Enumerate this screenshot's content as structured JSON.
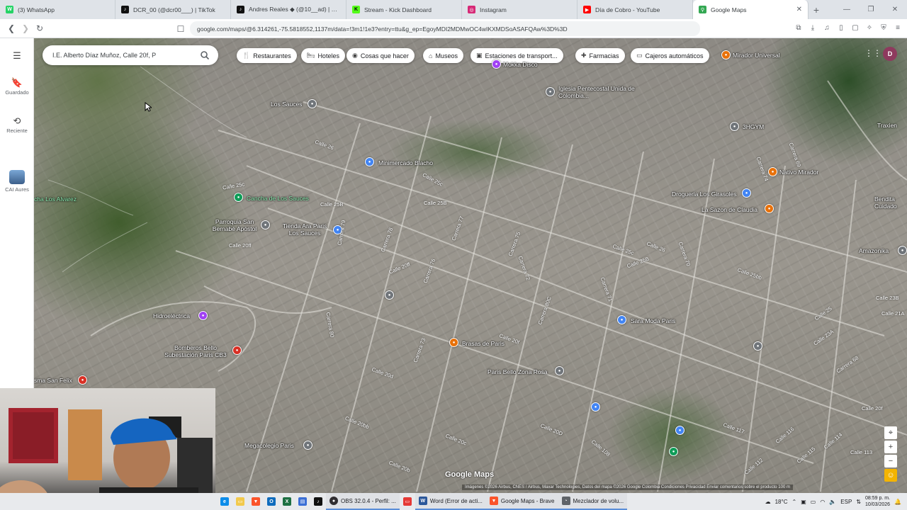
{
  "browser": {
    "tabs": [
      {
        "label": "(3) WhatsApp",
        "icon": "whatsapp-icon",
        "color": "#25d366",
        "glyph": "W"
      },
      {
        "label": "DCR_00 (@dcr00___) | TikTok",
        "icon": "tiktok-icon",
        "color": "#111111",
        "glyph": "♪"
      },
      {
        "label": "Andres Reales ◆ (@10__ad) | TikTok",
        "icon": "tiktok-icon",
        "color": "#111111",
        "glyph": "♪"
      },
      {
        "label": "Stream - Kick Dashboard",
        "icon": "kick-icon",
        "color": "#53fc18",
        "glyph": "K"
      },
      {
        "label": "Instagram",
        "icon": "instagram-icon",
        "color": "#d62976",
        "glyph": "◎"
      },
      {
        "label": "Día de Cobro - YouTube",
        "icon": "youtube-icon",
        "color": "#ff0000",
        "glyph": "▶"
      },
      {
        "label": "Google Maps",
        "icon": "google-maps-icon",
        "color": "#34a853",
        "glyph": "⚲"
      }
    ],
    "url": "google.com/maps/@6.314261,-75.5818552,1137m/data=!3m1!1e3?entry=ttu&g_ep=EgoyMDI2MDMwOC4wIKXMDSoASAFQAw%3D%3D"
  },
  "rail": {
    "items": [
      {
        "label": "Guardado",
        "icon": "bookmark-icon"
      },
      {
        "label": "Reciente",
        "icon": "history-icon"
      },
      {
        "label": "CAI Aures",
        "icon": "place-thumbnail"
      }
    ]
  },
  "search": {
    "value": "I.E. Alberto Díaz Muñoz, Calle 20f, P"
  },
  "chips": [
    {
      "label": "Restaurantes",
      "icon": "restaurant-icon",
      "glyph": "🍴"
    },
    {
      "label": "Hoteles",
      "icon": "hotel-icon",
      "glyph": "🛏"
    },
    {
      "label": "Cosas que hacer",
      "icon": "camera-icon",
      "glyph": "◉"
    },
    {
      "label": "Museos",
      "icon": "museum-icon",
      "glyph": "⌂"
    },
    {
      "label": "Estaciones de transport...",
      "icon": "transit-icon",
      "glyph": "▣"
    },
    {
      "label": "Farmacias",
      "icon": "pharmacy-icon",
      "glyph": "✚"
    },
    {
      "label": "Cajeros automáticos",
      "icon": "atm-icon",
      "glyph": "▭"
    }
  ],
  "map": {
    "places": [
      {
        "label": "Mirador Universal",
        "color": "#e8710a"
      },
      {
        "label": "Mokka Disco",
        "color": "#a142f4"
      },
      {
        "label": "Iglesia Pentecostal Unida de Colombia...",
        "color": "#70757a"
      },
      {
        "label": "Los Sauces",
        "color": "#70757a"
      },
      {
        "label": "3HGYM",
        "color": "#70757a"
      },
      {
        "label": "Traxien",
        "color": "#70757a"
      },
      {
        "label": "Nativo Mirador",
        "color": "#e8710a"
      },
      {
        "label": "Minimercado Blacho",
        "color": "#4285f4"
      },
      {
        "label": "Cancha de Los Sauces",
        "color": "#0f9d58"
      },
      {
        "label": "Drogueria Los Girasoles",
        "color": "#4285f4"
      },
      {
        "label": "La Sazon de Claudia",
        "color": "#e8710a"
      },
      {
        "label": "Bendita Cuidado",
        "color": "#70757a"
      },
      {
        "label": "Parroquia San Bernabé Apóstol",
        "color": "#70757a"
      },
      {
        "label": "Tienda Ara Paris Los Sauces",
        "color": "#4285f4"
      },
      {
        "label": "Amazonika",
        "color": "#70757a"
      },
      {
        "label": "Hidroeléctrica",
        "color": "#a142f4"
      },
      {
        "label": "Sara Moda Paris",
        "color": "#4285f4"
      },
      {
        "label": "Brasas de Paris",
        "color": "#e8710a"
      },
      {
        "label": "Bomberos Bello Subestación Paris CB3",
        "color": "#d93025"
      },
      {
        "label": "Paris Bello Zona Rosa",
        "color": "#70757a"
      },
      {
        "label": "Megacolegio Paris",
        "color": "#70757a"
      },
      {
        "label": "sma San Felix",
        "color": "#d93025"
      },
      {
        "label": "cha Los Alvarez",
        "color": "#0f9d58"
      }
    ],
    "streets": [
      "Calle 26",
      "Calle 25c",
      "Calle 25B",
      "Calle 25c",
      "Calle 25B",
      "Calle 20ff",
      "Calle 20ff",
      "Calle 25B",
      "Calle 25c",
      "Calle 26",
      "Calle 25bb",
      "Calle 25",
      "Calle 23A",
      "Calle 20f",
      "Calle 20d",
      "Calle 20bb",
      "Calle 20c",
      "Calle 20b",
      "Calle 20D",
      "Calle 117",
      "Calle 116",
      "Calle 113",
      "Calle 114",
      "Calle 115",
      "Calle 112",
      "Calle 108",
      "Calle 20f",
      "Carrera 69",
      "Carrera 70",
      "Carrera 71",
      "Carrera 72",
      "Carrera 73",
      "Carrera 75",
      "Carrera 76",
      "Carrera 77",
      "Carrera 78",
      "Carrera 79",
      "Carrera 80",
      "Carrera 80C",
      "Carrera 74",
      "Carrera 68",
      "Calle 21A",
      "Calle 23B",
      "Calle 24"
    ],
    "logo": "Google Maps",
    "attribution": "Imágenes ©2026 Airbus, CNES / Airbus, Maxar Technologies, Datos del mapa ©2026 Google   Colombia   Condiciones   Privacidad   Enviar comentarios sobre el producto   100 m",
    "avatar_letter": "D"
  },
  "taskbar": {
    "apps": [
      {
        "label": "OBS 32.0.4 - Perfil: ...",
        "icon": "obs-icon",
        "color": "#302e31",
        "glyph": "●"
      },
      {
        "label": "Word (Error de acti...",
        "icon": "word-icon",
        "color": "#2b579a",
        "glyph": "W"
      },
      {
        "label": "Google Maps - Brave",
        "icon": "brave-icon",
        "color": "#fb542b",
        "glyph": "▼"
      },
      {
        "label": "Mezclador de volu...",
        "icon": "volume-mixer-icon",
        "color": "#5f6368",
        "glyph": "◔"
      }
    ],
    "weather": "18°C",
    "lang": "ESP",
    "time": "08:59 p. m.",
    "date": "10/03/2026"
  },
  "colors": {
    "accent": "#1a73e8",
    "tab_active": "#ffffff",
    "chrome": "#dfe3e8"
  }
}
